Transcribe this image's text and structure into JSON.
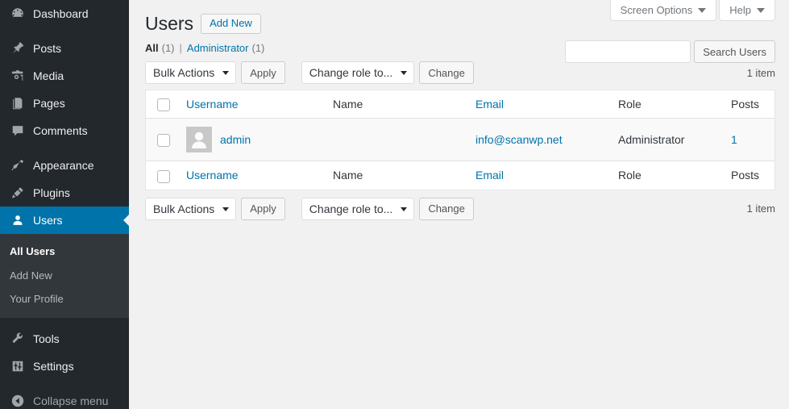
{
  "sidebar": {
    "items": [
      {
        "label": "Dashboard",
        "icon": "dashboard-icon",
        "current": false
      },
      {
        "label": "Posts",
        "icon": "pin-icon",
        "current": false
      },
      {
        "label": "Media",
        "icon": "media-icon",
        "current": false
      },
      {
        "label": "Pages",
        "icon": "pages-icon",
        "current": false
      },
      {
        "label": "Comments",
        "icon": "comments-icon",
        "current": false
      },
      {
        "label": "Appearance",
        "icon": "paintbrush-icon",
        "current": false
      },
      {
        "label": "Plugins",
        "icon": "plugin-icon",
        "current": false
      },
      {
        "label": "Users",
        "icon": "users-icon",
        "current": true
      }
    ],
    "submenu": [
      {
        "label": "All Users",
        "current": true
      },
      {
        "label": "Add New",
        "current": false
      },
      {
        "label": "Your Profile",
        "current": false
      }
    ],
    "items_after": [
      {
        "label": "Tools",
        "icon": "wrench-icon",
        "current": false
      },
      {
        "label": "Settings",
        "icon": "settings-icon",
        "current": false
      }
    ],
    "collapse": {
      "label": "Collapse menu",
      "icon": "collapse-arrow-icon"
    }
  },
  "screen_meta": {
    "screen_options": "Screen Options",
    "help": "Help"
  },
  "header": {
    "title": "Users",
    "add_new": "Add New"
  },
  "search": {
    "value": "",
    "placeholder": "",
    "button": "Search Users"
  },
  "filters": [
    {
      "label": "All",
      "count": "(1)",
      "current": true
    },
    {
      "label": "Administrator",
      "count": "(1)",
      "current": false
    }
  ],
  "filters_separator": "|",
  "tablenav": {
    "bulk_actions": "Bulk Actions",
    "apply": "Apply",
    "change_role": "Change role to...",
    "change": "Change",
    "displaying_num": "1 item"
  },
  "table": {
    "columns": [
      {
        "label": "Username",
        "sortable": true
      },
      {
        "label": "Name",
        "sortable": false
      },
      {
        "label": "Email",
        "sortable": true
      },
      {
        "label": "Role",
        "sortable": false
      },
      {
        "label": "Posts",
        "sortable": false
      }
    ],
    "rows": [
      {
        "username": "admin",
        "name": "",
        "email": "info@scanwp.net",
        "role": "Administrator",
        "posts": "1",
        "avatar": "default-mystery-person-avatar"
      }
    ]
  },
  "colors": {
    "accent": "#0073aa",
    "sidebar_bg": "#23282d",
    "submenu_bg": "#32373c",
    "page_bg": "#f1f1f1",
    "row_bg": "#f9f9f9"
  }
}
